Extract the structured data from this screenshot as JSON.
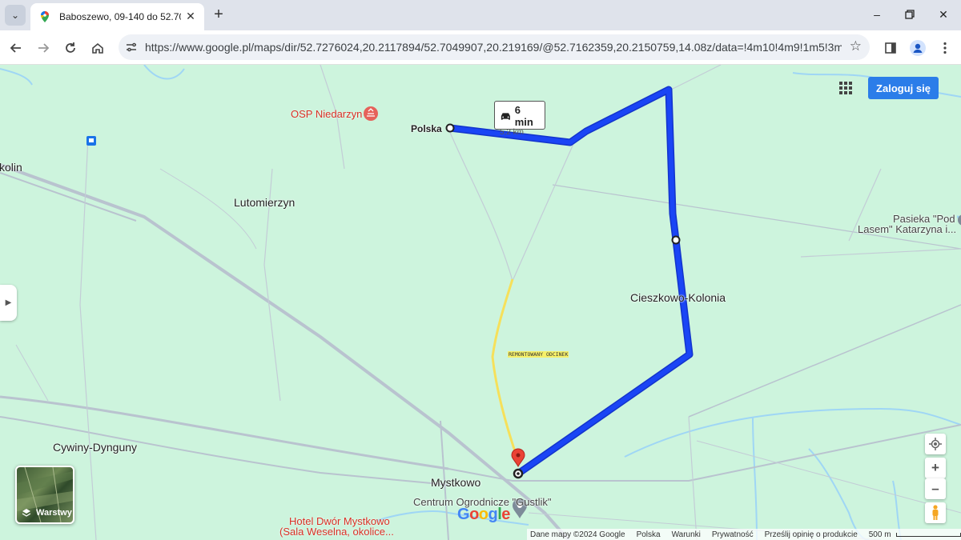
{
  "browser": {
    "tab_title": "Baboszewo, 09-140 do 52.7049...",
    "url": "https://www.google.pl/maps/dir/52.7276024,20.2117894/52.7049907,20.219169/@52.7162359,20.2150759,14.08z/data=!4m10!4m9!1m5!3m4!1m2!1...",
    "icons": {
      "tab_menu": "chevron-down-icon",
      "favicon": "google-maps-icon",
      "tab_close": "close-icon",
      "new_tab": "plus-icon",
      "minimize": "minimize-icon",
      "maximize": "restore-icon",
      "close_window": "close-icon",
      "back": "back-arrow-icon",
      "forward": "forward-arrow-icon",
      "reload": "reload-icon",
      "home": "home-icon",
      "site_info": "tune-icon",
      "bookmark": "star-icon",
      "side_panel": "side-panel-icon",
      "profile": "profile-icon",
      "menu": "kebab-menu-icon"
    }
  },
  "map": {
    "signin_label": "Zaloguj się",
    "route": {
      "time": "6 min",
      "distance": "5,2 km",
      "color": "#1a3df0"
    },
    "places": {
      "polska_pin": "Polska",
      "kolin": "kolin",
      "lutomierzyn": "Lutomierzyn",
      "cieszkowo": "Cieszkowo-Kolonia",
      "cywiny": "Cywiny-Dynguny",
      "mystkowo": "Mystkowo",
      "pasieka_1": "Pasieka \"Pod",
      "pasieka_2": "Lasem\" Katarzyna i...",
      "centrum": "Centrum Ogrodnicze \"Gustlik\" ",
      "osp": "OSP Niedarzyn",
      "hotel_1": "Hotel Dwór Mystkowo",
      "hotel_2": "(Sala Weselna, okolice..."
    },
    "annotation": "REMONTOWANY ODCINEK",
    "layers_label": "Warstwy",
    "google_logo": "Google",
    "footer": {
      "copyright": "Dane mapy ©2024 Google",
      "country": "Polska",
      "terms": "Warunki",
      "privacy": "Prywatność",
      "feedback": "Prześlij opinię o produkcie",
      "scale": "500 m"
    },
    "colors": {
      "land": "#cdf4dd",
      "signin": "#2b7de9",
      "highlight": "#f6e05a",
      "pin": "#ea4335"
    }
  }
}
